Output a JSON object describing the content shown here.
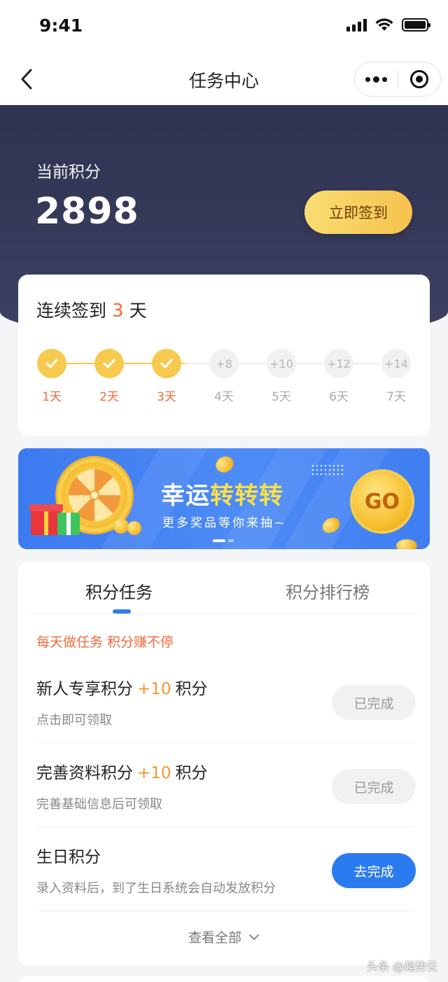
{
  "status_bar": {
    "time": "9:41"
  },
  "nav": {
    "title": "任务中心"
  },
  "header": {
    "points_label": "当前积分",
    "points_value": "2898",
    "signin_button": "立即签到"
  },
  "streak": {
    "title_prefix": "连续签到",
    "days": "3",
    "title_suffix": "天",
    "steps": [
      {
        "day": "1天",
        "done": true,
        "reward": ""
      },
      {
        "day": "2天",
        "done": true,
        "reward": ""
      },
      {
        "day": "3天",
        "done": true,
        "reward": ""
      },
      {
        "day": "4天",
        "done": false,
        "reward": "+8"
      },
      {
        "day": "5天",
        "done": false,
        "reward": "+10"
      },
      {
        "day": "6天",
        "done": false,
        "reward": "+12"
      },
      {
        "day": "7天",
        "done": false,
        "reward": "+14"
      }
    ]
  },
  "banner": {
    "title_part1": "幸运",
    "title_part2": "转转转",
    "subtitle": "更多奖品等你来抽~",
    "go_label": "GO"
  },
  "tasks": {
    "tabs": [
      {
        "label": "积分任务",
        "active": true
      },
      {
        "label": "积分排行榜",
        "active": false
      }
    ],
    "slogan": "每天做任务 积分赚不停",
    "items": [
      {
        "name": "新人专享积分",
        "plus": "+10",
        "unit": "积分",
        "desc": "点击即可领取",
        "button": "已完成",
        "state": "done"
      },
      {
        "name": "完善资料积分",
        "plus": "+10",
        "unit": "积分",
        "desc": "完善基础信息后可领取",
        "button": "已完成",
        "state": "done"
      },
      {
        "name": "生日积分",
        "plus": "",
        "unit": "",
        "desc": "录入资料后，到了生日系统会自动发放积分",
        "button": "去完成",
        "state": "todo"
      }
    ],
    "view_all": "查看全部"
  },
  "watermark": "头条 @趋势云",
  "colors": {
    "header": "#2f3350",
    "accent_orange": "#f26a3d",
    "gold": "#f6ca4e",
    "primary_blue": "#2b7bf0"
  }
}
